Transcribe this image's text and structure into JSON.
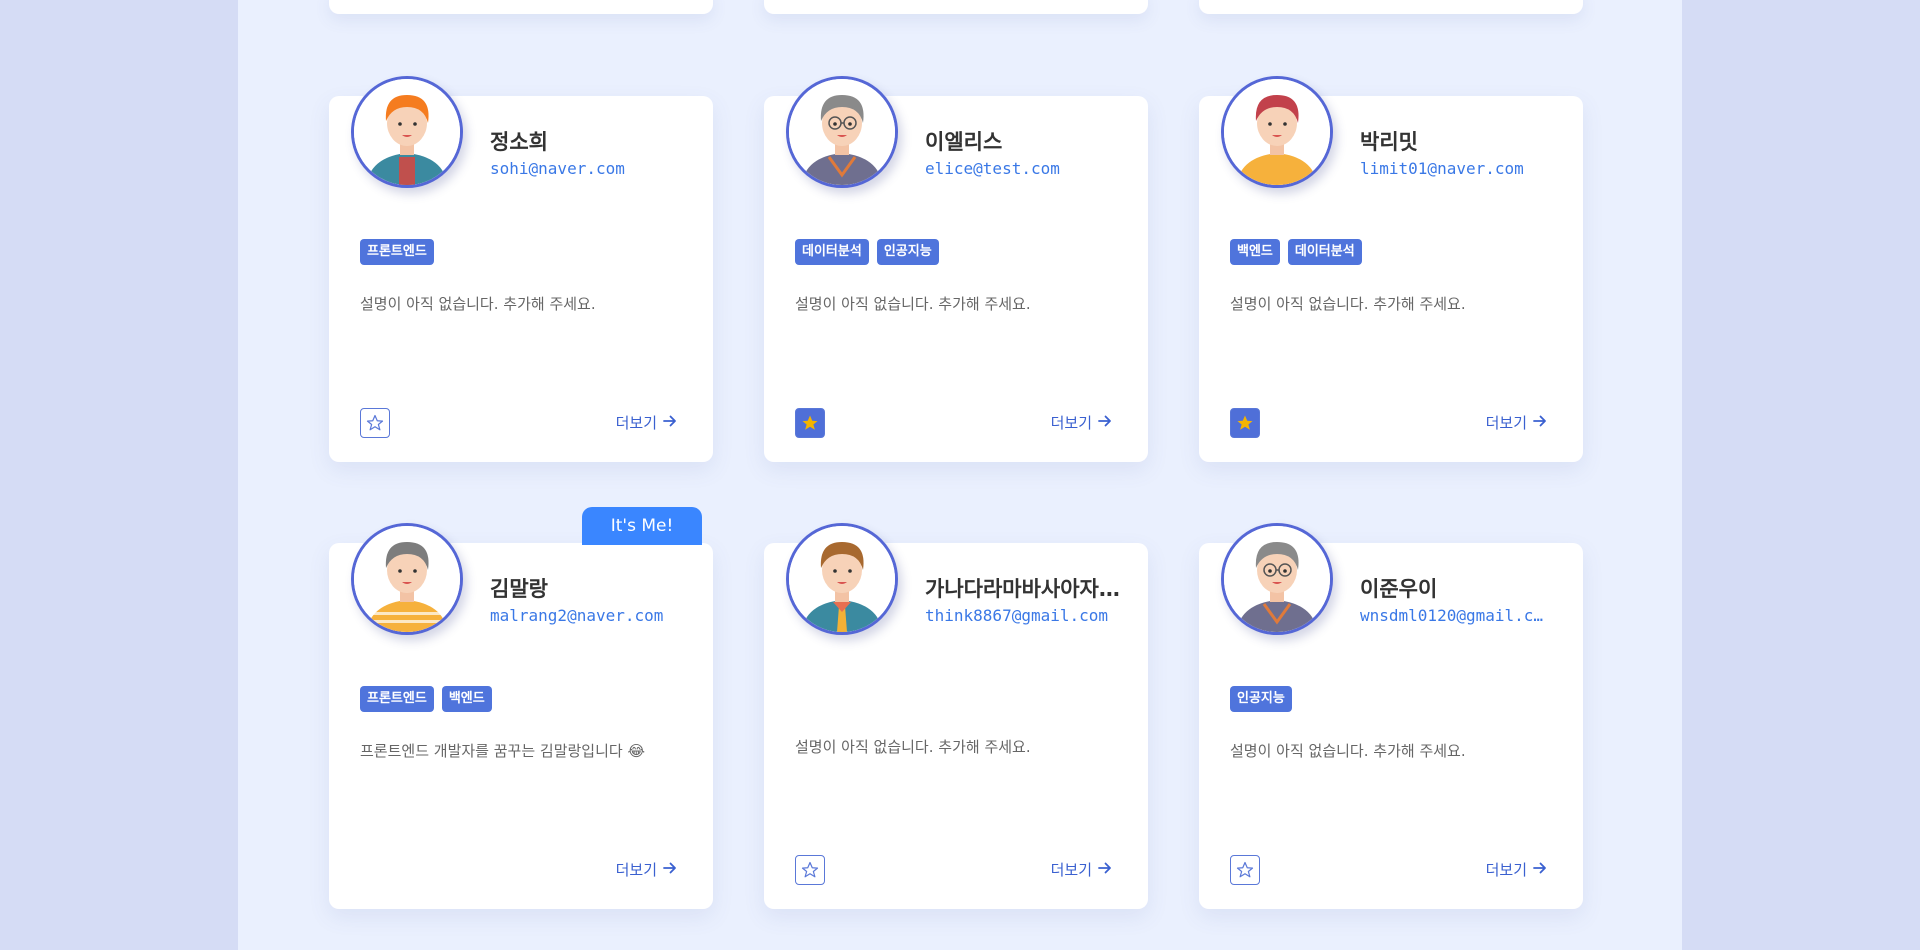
{
  "colors": {
    "page_background": "#d5dcf5",
    "panel_background": "#eaf0fe",
    "accent": "#4f74dc",
    "link_blue": "#3a78e6",
    "me_badge": "#3a86ff",
    "star_gold": "#f4b400"
  },
  "cards": [
    {
      "name": "정소희",
      "email": "sohi@naver.com",
      "tags": [
        "프론트엔드"
      ],
      "description": "설명이 아직 없습니다. 추가해 주세요.",
      "favorite": false,
      "more_label": "더보기",
      "avatar": "orange-hair-woman-avatar"
    },
    {
      "name": "이엘리스",
      "email": "elice@test.com",
      "tags": [
        "데이터분석",
        "인공지능"
      ],
      "description": "설명이 아직 없습니다. 추가해 주세요.",
      "favorite": true,
      "more_label": "더보기",
      "avatar": "gray-hair-glasses-man-avatar"
    },
    {
      "name": "박리밋",
      "email": "limit01@naver.com",
      "tags": [
        "백엔드",
        "데이터분석"
      ],
      "description": "설명이 아직 없습니다. 추가해 주세요.",
      "favorite": true,
      "more_label": "더보기",
      "avatar": "red-hair-yellow-shirt-avatar"
    },
    {
      "name": "김말랑",
      "email": "malrang2@naver.com",
      "tags": [
        "프론트엔드",
        "백엔드"
      ],
      "description": "프론트엔드 개발자를 꿈꾸는 김말랑입니다 😂",
      "favorite": null,
      "more_label": "더보기",
      "me_badge": "It's Me!",
      "avatar": "gray-hair-striped-shirt-woman-avatar"
    },
    {
      "name": "가나다라마바사아자…",
      "email": "think8867@gmail.com",
      "tags": [],
      "description": "설명이 아직 없습니다. 추가해 주세요.",
      "favorite": false,
      "more_label": "더보기",
      "avatar": "brown-hair-tie-man-avatar"
    },
    {
      "name": "이준우이",
      "email": "wnsdml0120@gmail.c…",
      "tags": [
        "인공지능"
      ],
      "description": "설명이 아직 없습니다. 추가해 주세요.",
      "favorite": false,
      "more_label": "더보기",
      "avatar": "gray-hair-glasses-man-avatar"
    }
  ]
}
